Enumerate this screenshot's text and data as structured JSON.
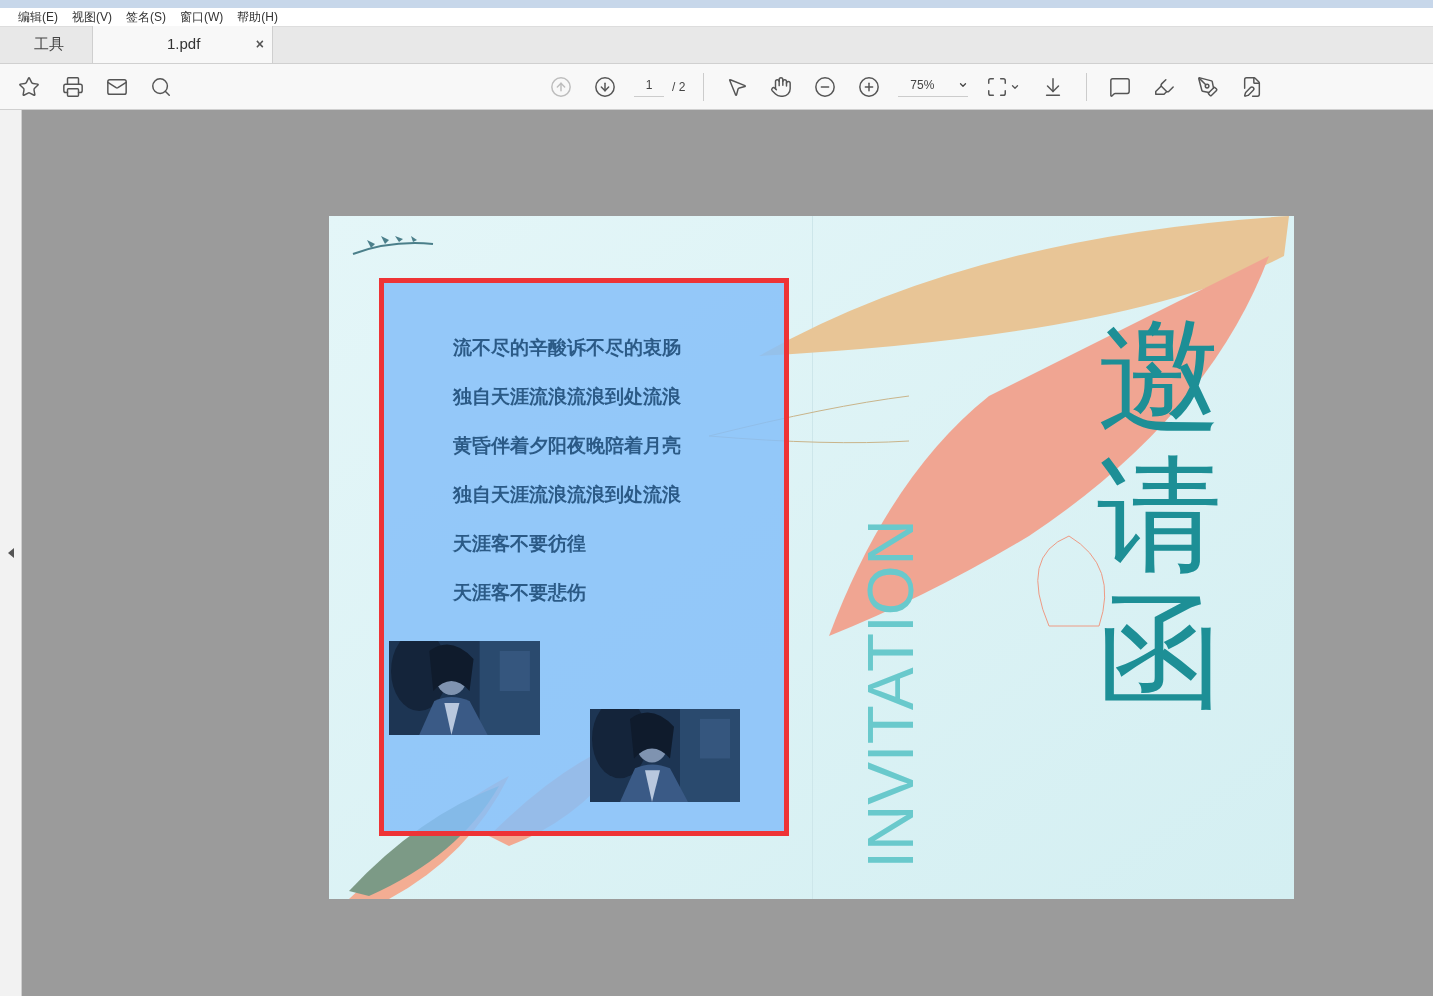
{
  "menu": [
    "编辑(E)",
    "视图(V)",
    "签名(S)",
    "窗口(W)",
    "帮助(H)"
  ],
  "tabs": [
    {
      "label": "工具",
      "selected": false
    },
    {
      "label": "1.pdf",
      "selected": true,
      "close": "×"
    }
  ],
  "toolbar": {
    "page_current": "1",
    "page_total": "/ 2",
    "zoom": "75%"
  },
  "document": {
    "selection": true,
    "lines": [
      "流不尽的辛酸诉不尽的衷肠",
      "独自天涯流浪流浪到处流浪",
      "黄昏伴着夕阳夜晚陪着月亮",
      "独自天涯流浪流浪到处流浪",
      "天涯客不要彷徨",
      "天涯客不要悲伤"
    ],
    "subtitle": "INVITATION",
    "title": "邀请函"
  }
}
